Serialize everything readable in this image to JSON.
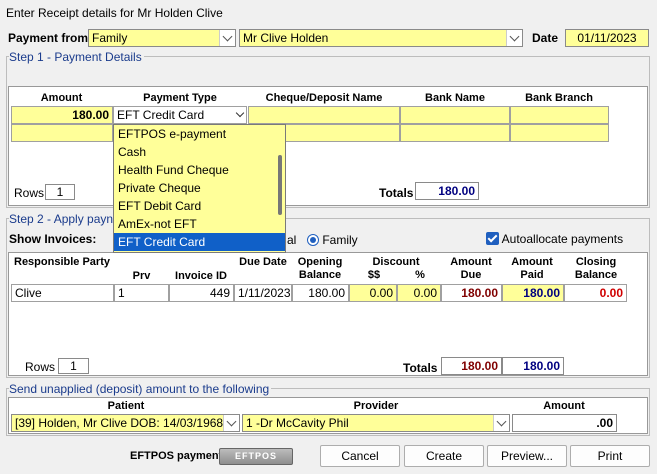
{
  "window": {
    "title": "Enter Receipt details for Mr  Holden  Clive"
  },
  "header": {
    "payment_from_label": "Payment from",
    "payment_from_value": "Family",
    "person_value": "Mr Clive  Holden",
    "date_label": "Date",
    "date_value": "01/11/2023"
  },
  "step1": {
    "title": "Step 1 - Payment Details",
    "columns": [
      "Amount",
      "Payment Type",
      "Cheque/Deposit Name",
      "Bank Name",
      "Bank Branch"
    ],
    "row1": {
      "amount": "180.00",
      "payment_type": "EFT Credit Card"
    },
    "rows_label": "Rows",
    "rows_value": "1",
    "totals_label": "Totals",
    "totals_value": "180.00"
  },
  "dropdown": {
    "options": [
      "EFTPOS e-payment",
      "Cash",
      "Health Fund Cheque",
      "Private Cheque",
      "EFT Debit Card",
      "AmEx-not EFT",
      "EFT Credit Card"
    ],
    "selected": "EFT Credit Card"
  },
  "step2": {
    "title": "Step 2 - Apply payn",
    "show_invoices_label": "Show Invoices:",
    "radio_individual_partial": "al",
    "radio_family": "Family",
    "autoallocate_label": "Autoallocate payments",
    "headers": {
      "party": "Responsible Party",
      "prv": "Prv",
      "invoice_id": "Invoice ID",
      "due_date": "Due Date",
      "opening_balance": "Opening Balance",
      "discount": "Discount",
      "discount_dollars": "$$",
      "discount_pct": "%",
      "amount_due": "Amount Due",
      "amount_paid": "Amount Paid",
      "closing_balance": "Closing Balance"
    },
    "row": {
      "party": "Clive",
      "prv": "1",
      "invoice_id": "449",
      "due_date": "1/11/2023",
      "opening_balance": "180.00",
      "discount_dollars": "0.00",
      "discount_pct": "0.00",
      "amount_due": "180.00",
      "amount_paid": "180.00",
      "closing_balance": "0.00"
    },
    "rows_label": "Rows",
    "rows_value": "1",
    "totals_label": "Totals",
    "totals_due": "180.00",
    "totals_paid": "180.00"
  },
  "unapplied": {
    "title": "Send unapplied (deposit) amount to the following",
    "patient_label": "Patient",
    "provider_label": "Provider",
    "amount_label": "Amount",
    "patient_value": "[39] Holden, Mr Clive DOB: 14/03/1968",
    "provider_value": "1 -Dr McCavity Phil",
    "amount_value": ".00"
  },
  "footer": {
    "eftpos_label": "EFTPOS payment",
    "eftpos_badge": "EFTPOS",
    "cancel": "Cancel",
    "create": "Create",
    "preview": "Preview...",
    "print": "Print"
  },
  "colors": {
    "field_yellow": "#ffff99",
    "group_title": "#1a3b8c",
    "selection": "#1060c8"
  }
}
